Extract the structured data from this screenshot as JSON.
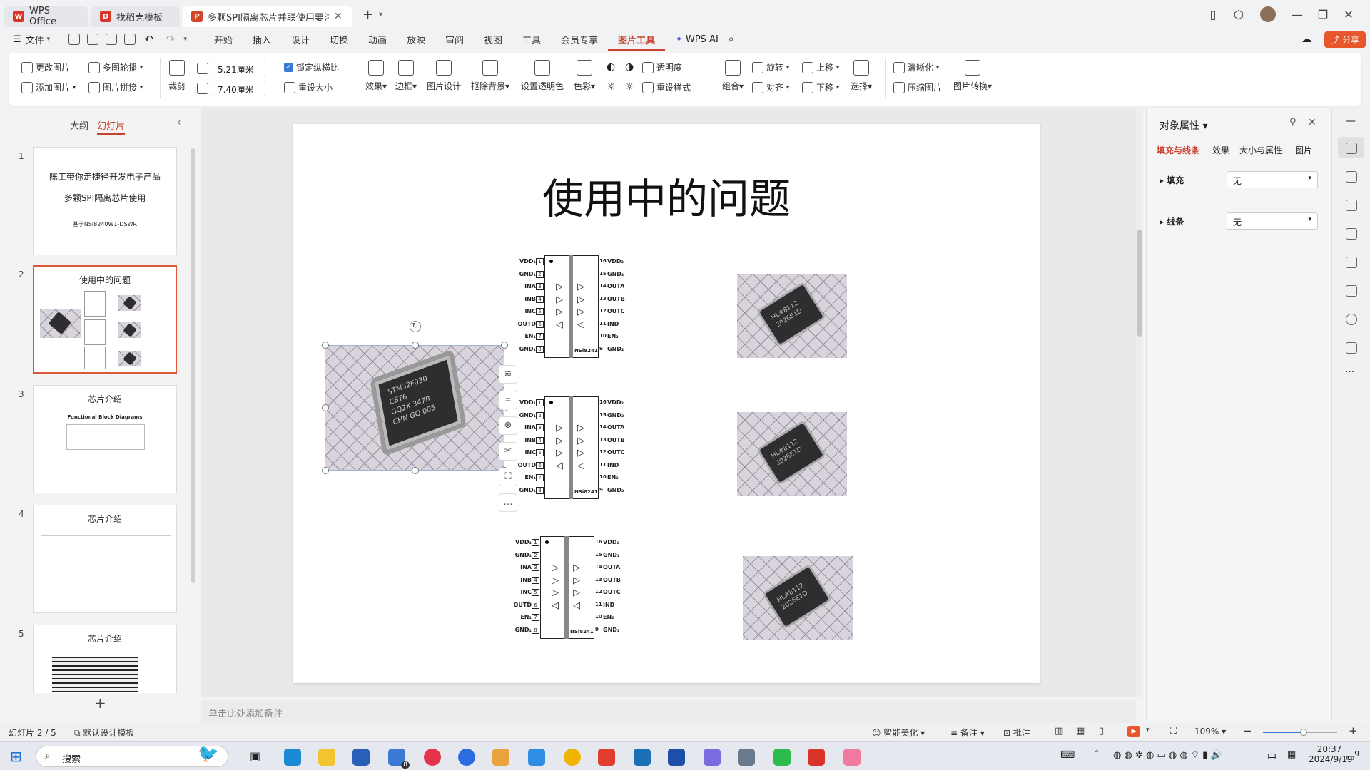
{
  "tabs": [
    {
      "label": "WPS Office",
      "icon": "wps-logo-icon"
    },
    {
      "label": "找稻壳模板",
      "icon": "docer-icon"
    },
    {
      "label": "多颗SPI隔离芯片并联使用要注",
      "icon": "ppt-file-icon"
    }
  ],
  "menu": {
    "file": "文件",
    "items": [
      "开始",
      "插入",
      "设计",
      "切换",
      "动画",
      "放映",
      "审阅",
      "视图",
      "工具",
      "会员专享",
      "图片工具"
    ],
    "active": "图片工具",
    "wps_ai": "WPS AI",
    "share": "分享"
  },
  "ribbon": {
    "change_image": "更改图片",
    "add_image": "添加图片",
    "multi_carousel": "多图轮播",
    "image_splice": "图片拼接",
    "crop": "裁剪",
    "width_value": "5.21厘米",
    "height_value": "7.40厘米",
    "lock_ratio": "锁定纵横比",
    "reset_size": "重设大小",
    "effects": "效果",
    "border": "边框",
    "image_design": "图片设计",
    "remove_bg": "抠除背景",
    "set_transparent": "设置透明色",
    "color": "色彩",
    "transparency": "透明度",
    "reset_style": "重设样式",
    "group": "组合",
    "rotate": "旋转",
    "align": "对齐",
    "move_up": "上移",
    "move_down": "下移",
    "select": "选择",
    "sharpen": "清晰化",
    "compress": "压缩图片",
    "image_convert": "图片转换"
  },
  "left_panel": {
    "tab_outline": "大纲",
    "tab_slides": "幻灯片",
    "slides": [
      {
        "num": "1",
        "title": "陈工带你走捷径开发电子产品",
        "line2": "多颗SPI隔离芯片使用",
        "line3": "基于NSi8240W1-DSWR"
      },
      {
        "num": "2",
        "title": "使用中的问题"
      },
      {
        "num": "3",
        "title": "芯片介绍",
        "line2": "Functional Block Diagrams"
      },
      {
        "num": "4",
        "title": "芯片介绍"
      },
      {
        "num": "5",
        "title": "芯片介绍"
      }
    ]
  },
  "slide": {
    "title": "使用中的问题",
    "chip_label": "NSi8241",
    "left_pins": [
      {
        "n": "1",
        "name": "VDD₁"
      },
      {
        "n": "2",
        "name": "GND₁"
      },
      {
        "n": "3",
        "name": "INA"
      },
      {
        "n": "4",
        "name": "INB"
      },
      {
        "n": "5",
        "name": "INC"
      },
      {
        "n": "6",
        "name": "OUTD"
      },
      {
        "n": "7",
        "name": "EN₁"
      },
      {
        "n": "8",
        "name": "GND₁"
      }
    ],
    "right_pins": [
      {
        "n": "16",
        "name": "VDD₂"
      },
      {
        "n": "15",
        "name": "GND₂"
      },
      {
        "n": "14",
        "name": "OUTA"
      },
      {
        "n": "13",
        "name": "OUTB"
      },
      {
        "n": "12",
        "name": "OUTC"
      },
      {
        "n": "11",
        "name": "IND"
      },
      {
        "n": "10",
        "name": "EN₂"
      },
      {
        "n": "9",
        "name": "GND₂"
      }
    ],
    "big_chip_marking": [
      "STM32F030",
      "C8T6",
      "GQ2X 347R",
      "CHN GQ 005"
    ],
    "small_chip_marking": [
      "HL#8112",
      "2026E1D"
    ]
  },
  "notes_placeholder": "单击此处添加备注",
  "right_panel": {
    "title": "对象属性",
    "tabs": [
      "填充与线条",
      "效果",
      "大小与属性",
      "图片"
    ],
    "fill_label": "填充",
    "fill_value": "无",
    "line_label": "线条",
    "line_value": "无"
  },
  "status": {
    "slide_info": "幻灯片 2 / 5",
    "template": "默认设计模板",
    "smart_beautify": "智能美化",
    "notes": "备注",
    "comments": "批注",
    "zoom": "109%"
  },
  "taskbar": {
    "search": "搜索",
    "time": "20:37",
    "date": "2024/9/19",
    "ime": "中",
    "notif_count": "9",
    "mail_badge": "8"
  },
  "colors": {
    "accent": "#c8412e",
    "share": "#e8572c",
    "selection": "#d9583a"
  }
}
